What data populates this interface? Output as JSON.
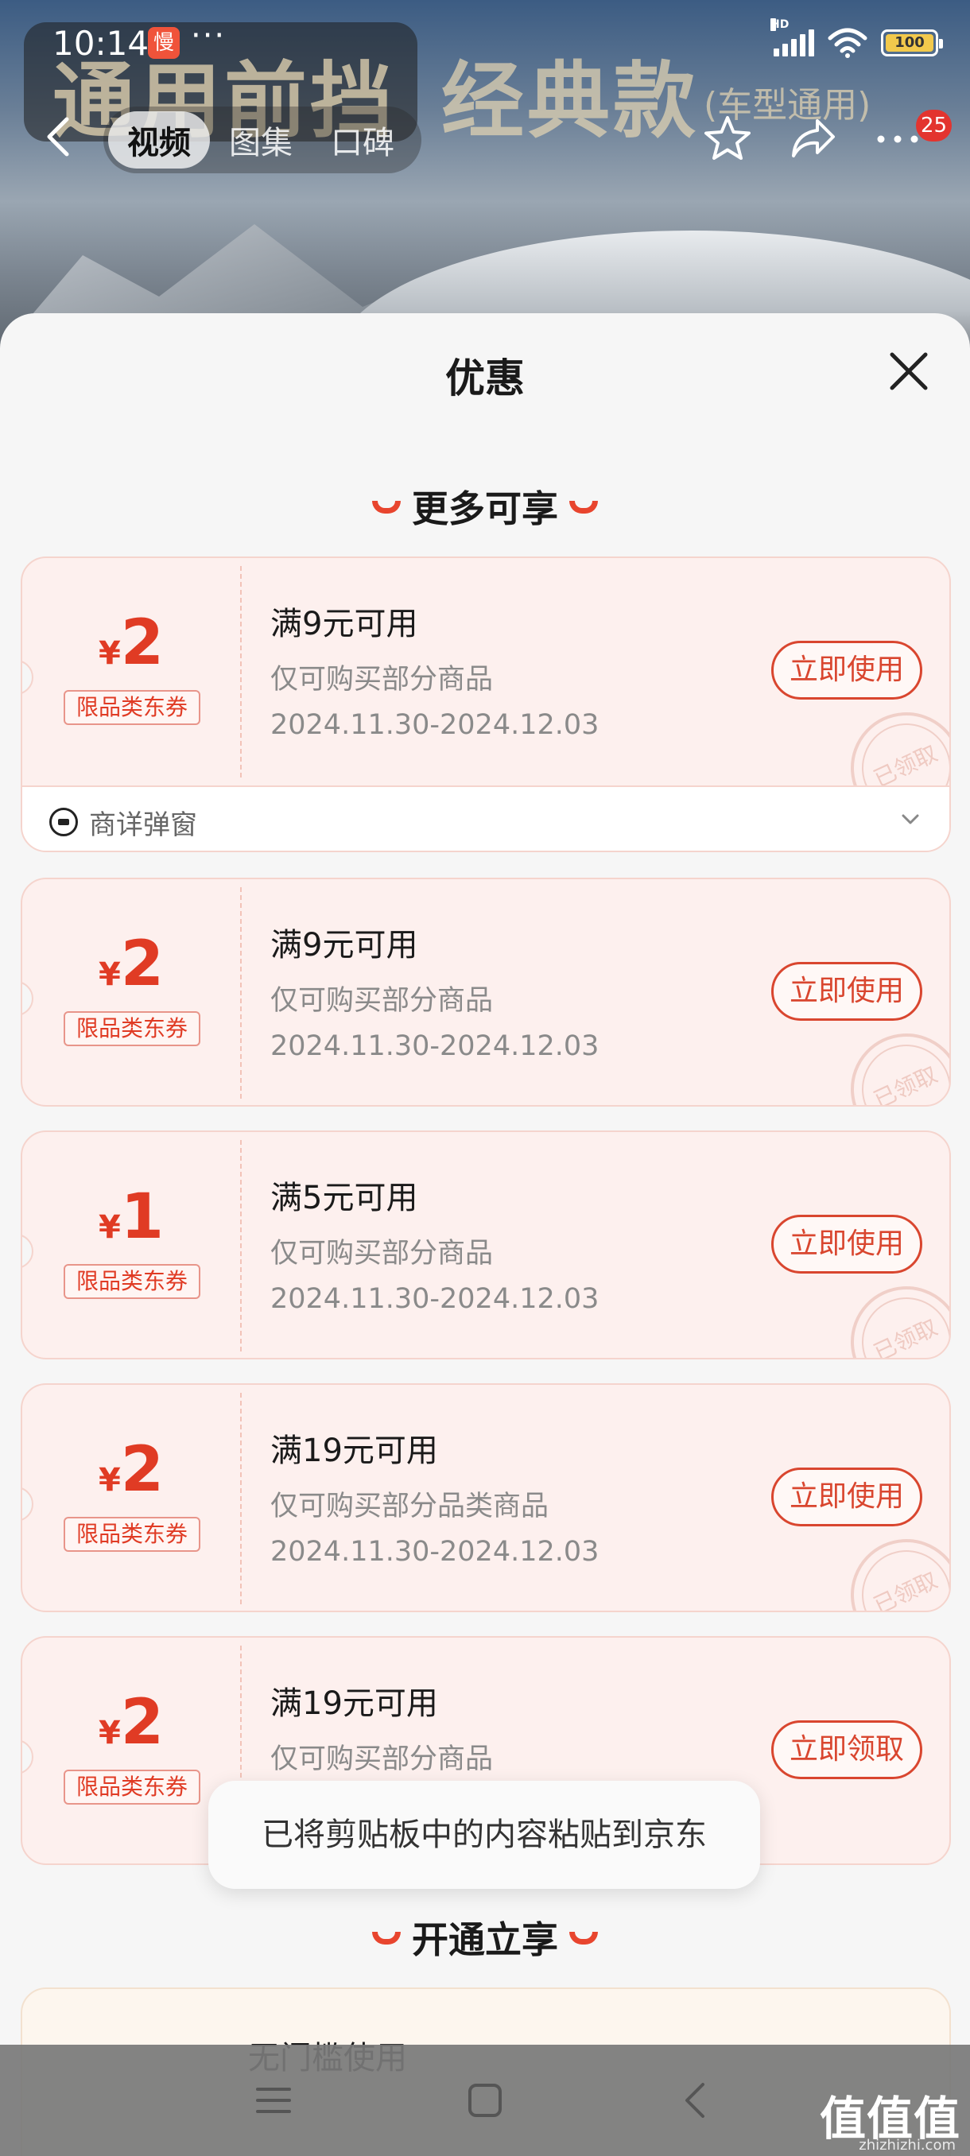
{
  "status_bar": {
    "time": "10:14",
    "app_badge": "慢",
    "more": "···",
    "network": "HD",
    "battery": "100"
  },
  "promo": {
    "line1": "通用前挡",
    "line2": "经典款",
    "line3": "(车型通用)"
  },
  "nav": {
    "tabs": [
      "视频",
      "图集",
      "口碑"
    ],
    "active_tab": 0,
    "badge_count": "25"
  },
  "sheet": {
    "title": "优惠",
    "section_more": "更多可享",
    "section_open": "开通立享"
  },
  "coupons": [
    {
      "currency": "¥",
      "amount": "2",
      "tag": "限品类东券",
      "condition": "满9元可用",
      "scope": "仅可购买部分商品",
      "date": "2024.11.30-2024.12.03",
      "button": "立即使用",
      "stamp": "已领取",
      "footer": "商详弹窗"
    },
    {
      "currency": "¥",
      "amount": "2",
      "tag": "限品类东券",
      "condition": "满9元可用",
      "scope": "仅可购买部分商品",
      "date": "2024.11.30-2024.12.03",
      "button": "立即使用",
      "stamp": "已领取"
    },
    {
      "currency": "¥",
      "amount": "1",
      "tag": "限品类东券",
      "condition": "满5元可用",
      "scope": "仅可购买部分商品",
      "date": "2024.11.30-2024.12.03",
      "button": "立即使用",
      "stamp": "已领取"
    },
    {
      "currency": "¥",
      "amount": "2",
      "tag": "限品类东券",
      "condition": "满19元可用",
      "scope": "仅可购买部分品类商品",
      "date": "2024.11.30-2024.12.03",
      "button": "立即使用",
      "stamp": "已领取"
    },
    {
      "currency": "¥",
      "amount": "2",
      "tag": "限品类东券",
      "condition": "满19元可用",
      "scope": "仅可购买部分商品",
      "button": "立即领取"
    }
  ],
  "member_card": {
    "condition": "无门槛使用"
  },
  "toast": "已将剪贴板中的内容粘贴到京东",
  "watermark": {
    "main": "值值值",
    "sub": "zhizhizhi.com"
  },
  "colors": {
    "accent": "#e03b24",
    "coupon_bg": "#fdf0ee",
    "sheet_bg": "#f6f6f6"
  }
}
